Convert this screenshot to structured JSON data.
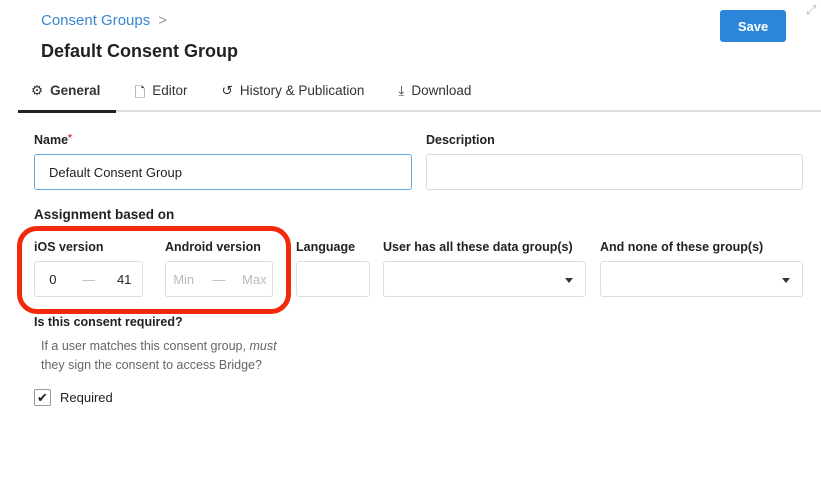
{
  "breadcrumb": {
    "parent": "Consent Groups",
    "separator": ">"
  },
  "title": "Default Consent Group",
  "save_label": "Save",
  "tabs": [
    {
      "label": "General",
      "icon": "gear-icon"
    },
    {
      "label": "Editor",
      "icon": "file-icon"
    },
    {
      "label": "History & Publication",
      "icon": "history-icon"
    },
    {
      "label": "Download",
      "icon": "download-icon"
    }
  ],
  "form": {
    "name_label": "Name",
    "required_mark": "*",
    "name_value": "Default Consent Group",
    "description_label": "Description",
    "description_value": "",
    "assignment_heading": "Assignment based on",
    "ios_label": "iOS version",
    "ios_min": "0",
    "ios_max": "41",
    "dash": "—",
    "android_label": "Android version",
    "android_min_placeholder": "Min",
    "android_max_placeholder": "Max",
    "language_label": "Language",
    "all_groups_label": "User has all these data group(s)",
    "none_groups_label": "And none of these group(s)",
    "required_question": "Is this consent required?",
    "help_pre": "If a user matches this consent group, ",
    "help_em": "must",
    "help_post": "they sign the consent to access Bridge?",
    "required_label": "Required",
    "required_checked": true
  }
}
